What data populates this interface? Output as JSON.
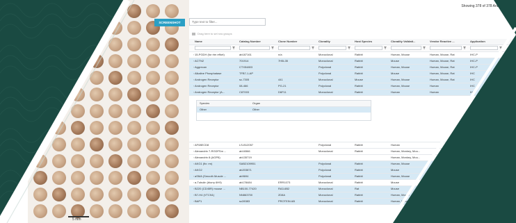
{
  "toolbar": {
    "screenshot_label": "SCREENSHOT",
    "search_placeholder": "Type text to filter..."
  },
  "status": {
    "count_text": "Showing 378 of 378 Antibodies"
  },
  "grid": {
    "group_hint": "Drag here to set row groups",
    "columns": [
      "Name",
      "Catalog Number",
      "Clone Number",
      "Clonality",
      "Host Species",
      "Clonality Validati...",
      "Vendor Reactive ...",
      "Application"
    ],
    "rows_top": [
      [
        "15-PGDH (for rtm effort)",
        "ab187161",
        "n/a",
        "Monoclonal",
        "Rabbit",
        "Human, Mouse",
        "Human, Mouse, Rat",
        "IHC-P"
      ],
      [
        "ACTN2",
        "701914",
        "7H5L35",
        "Monoclonal",
        "Rabbit",
        "Mouse",
        "Human, Mouse, Rat",
        "IHC-P"
      ],
      [
        "Aggrecan",
        "CTX54803",
        "",
        "Polyclonal",
        "Rabbit",
        "Human, Mouse",
        "Human, Mouse, Rat",
        "IHC-P"
      ],
      [
        "Alkaline Phosphatase",
        "TFB7-1-AP",
        "",
        "Polyclonal",
        "Rabbit",
        "Mouse",
        "Human, Mouse, Rat",
        "IHC"
      ],
      [
        "Androgen Receptor",
        "sc-7305",
        "441",
        "Monoclonal",
        "Mouse",
        "Human, Mouse",
        "Human, Mouse, Rat",
        "IHC"
      ],
      [
        "Androgen Receptor",
        "08-466",
        "PG-21",
        "Polyclonal",
        "Rabbit",
        "Human, Mouse",
        "Human",
        "IHC"
      ],
      [
        "Androgen Receptor (A...",
        "C87003",
        "D6F11",
        "Monoclonal",
        "Rabbit",
        "Human",
        "Human",
        "IHC"
      ]
    ],
    "detail": {
      "headers": [
        "Species",
        "Organ"
      ],
      "row": [
        "Other",
        "Other"
      ]
    },
    "rows_bottom": [
      [
        "AF08ECD8",
        "LS-B12057",
        "",
        "Polyclonal",
        "Rabbit",
        "Human",
        "",
        ""
      ],
      [
        "Alexandrin 7-RGDFSm ...",
        "ab16566",
        "",
        "Monoclonal",
        "Rabbit",
        "Human, Monkey, Mou...",
        "",
        ""
      ],
      [
        "Alexandrin 8 (AGP8)",
        "ab135719",
        "",
        "",
        "",
        "Human, Monkey, Mou...",
        "",
        ""
      ],
      [
        "AKG1 (fix: rm)",
        "SAB2109951",
        "",
        "Polyclonal",
        "Rabbit",
        "Human, Mouse",
        "",
        ""
      ],
      [
        "AKG2",
        "ab203871",
        "",
        "Polyclonal",
        "Rabbit",
        "Mouse",
        "",
        ""
      ],
      [
        "aSMA (Smooth Muscle ...",
        "ab9694",
        "",
        "Polyclonal",
        "Rabbit",
        "Human, Mouse",
        "",
        ""
      ],
      [
        "a-Tubulin (blurry 6H9)",
        "ab178484",
        "ERR1073",
        "Monoclonal",
        "Rabbit",
        "Mouse",
        "",
        ""
      ],
      [
        "B220 (CD45R) mouse ...",
        "NB100-77420",
        "RA3-6B2",
        "Monoclonal",
        "Rat",
        "Mouse",
        "",
        ""
      ],
      [
        "B7-H4 (VTCN1)",
        "NN863700",
        "2D8A",
        "Monoclonal",
        "Rabbit",
        "Human, Mouse",
        "",
        ""
      ],
      [
        "BAP1",
        "sc28383",
        "PROTEIN AB",
        "Monoclonal",
        "Rabbit",
        "Human, Mouse",
        "",
        ""
      ]
    ]
  },
  "tma": {
    "scale_label": "5 mm"
  },
  "colors": {
    "brand_dark": "#1a4a42",
    "accent": "#2a9fc4",
    "highlight_row": "#d6e9f5"
  }
}
